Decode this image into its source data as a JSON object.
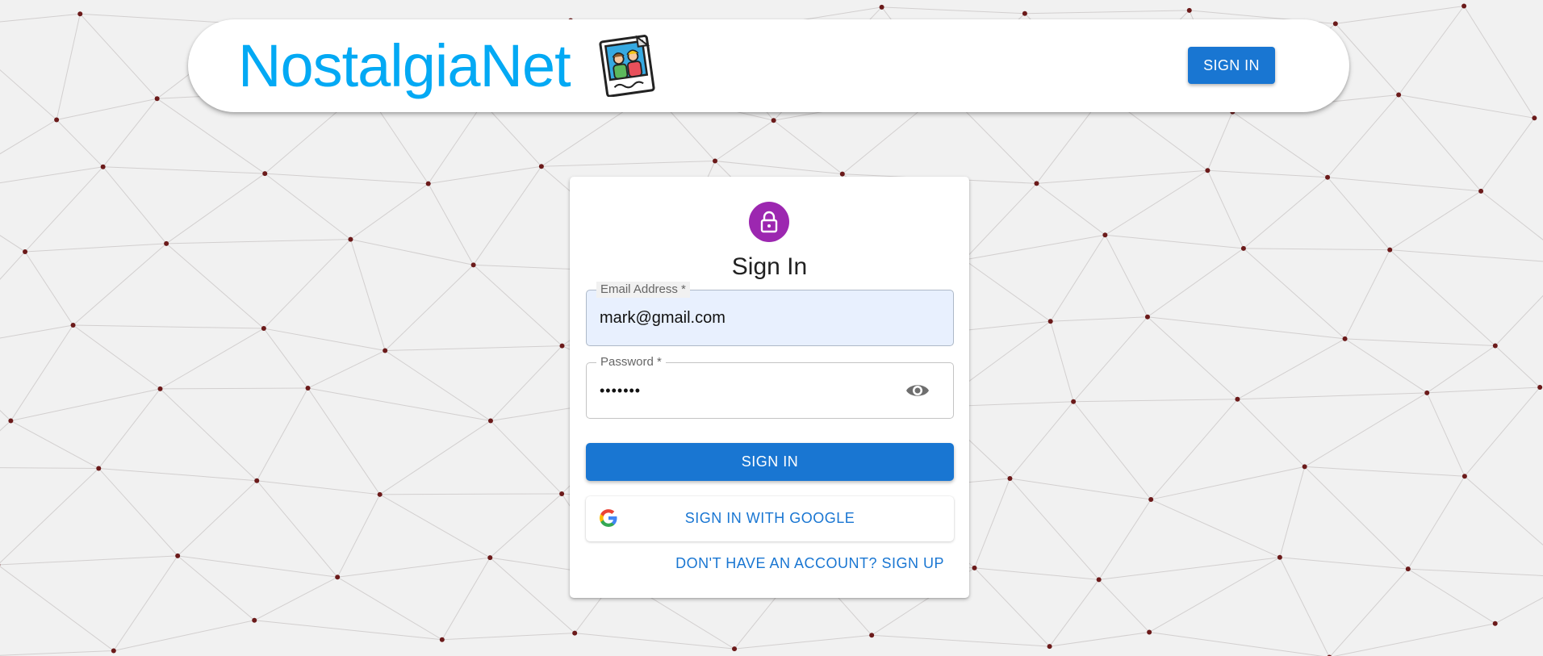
{
  "header": {
    "brand": "NostalgiaNet",
    "logo_icon": "polaroid-photo-icon",
    "signin_label": "SIGN IN"
  },
  "form": {
    "title": "Sign In",
    "lock_icon": "lock-icon",
    "email_label": "Email Address *",
    "email_value": "mark@gmail.com",
    "password_label": "Password *",
    "password_value": "•••••••",
    "visibility_icon": "eye-icon",
    "submit_label": "SIGN IN",
    "google_label": "SIGN IN WITH GOOGLE",
    "signup_link": "DON'T HAVE AN ACCOUNT? SIGN UP"
  },
  "colors": {
    "brand": "#03a9f4",
    "primary": "#1976d2",
    "avatar": "#9c27b0",
    "background": "#f1f1f1",
    "network_dots": "#6b1a1a"
  }
}
